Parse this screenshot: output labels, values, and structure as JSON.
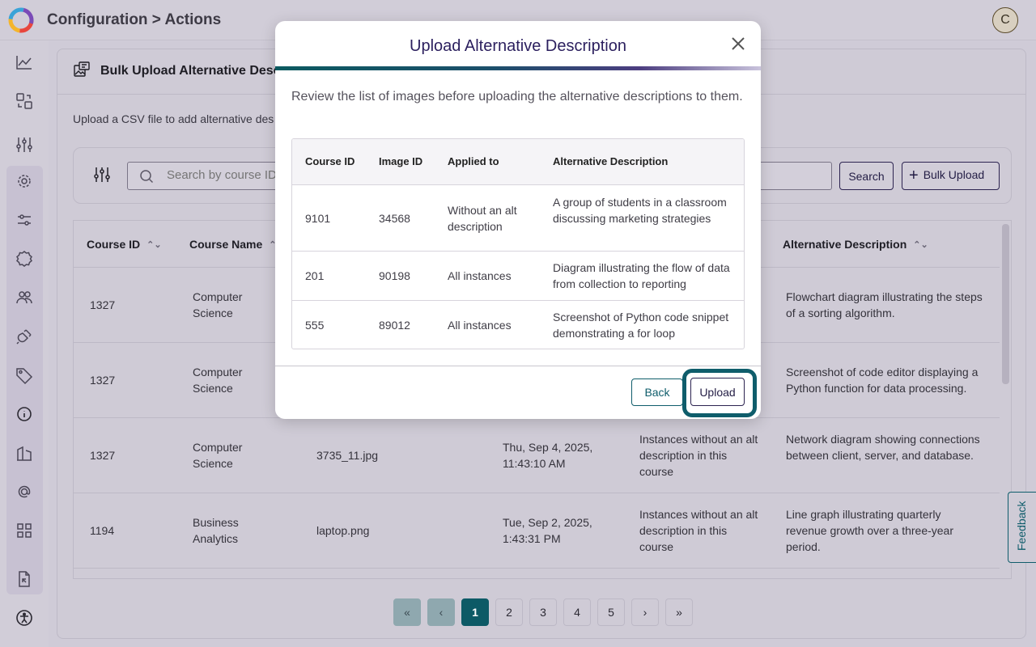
{
  "header": {
    "title": "Configuration > Actions",
    "avatar_initial": "C"
  },
  "section": {
    "title": "Bulk Upload Alternative Descr",
    "intro": "Upload a CSV file to add alternative des"
  },
  "filter": {
    "search_placeholder": "Search by course ID",
    "search_label": "Search",
    "bulk_label": "Bulk Upload"
  },
  "table": {
    "headers": [
      "Course ID",
      "Course Name",
      "Alternative Description"
    ],
    "rows": [
      {
        "course_id": "1327",
        "course_name": "Computer Science",
        "file": "",
        "date": "",
        "applied": "",
        "alt": "Flowchart diagram illustrating the steps of a sorting algorithm."
      },
      {
        "course_id": "1327",
        "course_name": "Computer Science",
        "file": "",
        "date": "",
        "applied": "",
        "alt": "Screenshot of code editor displaying a Python function for data processing."
      },
      {
        "course_id": "1327",
        "course_name": "Computer Science",
        "file": "3735_11.jpg",
        "date": "Thu, Sep 4, 2025, 11:43:10 AM",
        "applied": "Instances without an alt description in this course",
        "alt": "Network diagram showing connections between client, server, and database."
      },
      {
        "course_id": "1194",
        "course_name": "Business Analytics",
        "file": "laptop.png",
        "date": "Tue, Sep 2, 2025, 1:43:31 PM",
        "applied": "Instances without an alt description in this course",
        "alt": "Line graph illustrating quarterly revenue growth over a three-year period."
      }
    ]
  },
  "pagination": {
    "first": "«",
    "prev": "‹",
    "pages": [
      "1",
      "2",
      "3",
      "4",
      "5"
    ],
    "next": "›",
    "last": "»",
    "current": "1"
  },
  "feedback_label": "Feedback",
  "modal": {
    "title": "Upload Alternative Description",
    "description": "Review the list of images before uploading the alternative descriptions to them.",
    "headers": [
      "Course ID",
      "Image ID",
      "Applied to",
      "Alternative Description"
    ],
    "rows": [
      {
        "course_id": "9101",
        "image_id": "34568",
        "applied": "Without an alt description",
        "alt": "A group of students in a classroom discussing marketing strategies"
      },
      {
        "course_id": "201",
        "image_id": "90198",
        "applied": "All instances",
        "alt": "Diagram illustrating the flow of data from collection to reporting"
      },
      {
        "course_id": "555",
        "image_id": "89012",
        "applied": "All instances",
        "alt": "Screenshot of Python code snippet demonstrating a for loop"
      }
    ],
    "back_label": "Back",
    "upload_label": "Upload"
  },
  "icons": {
    "sidebar": [
      "chart-line-icon",
      "transfer-icon",
      "sliders-icon",
      "gear-icon",
      "filter-sliders-icon",
      "badge-icon",
      "users-icon",
      "plug-icon",
      "tag-icon",
      "info-icon",
      "building-icon",
      "at-sign-icon",
      "grid-icon",
      "file-import-icon",
      "accessibility-icon"
    ]
  },
  "colors": {
    "accent": "#0f5d6b",
    "primary_text": "#2b1f5e"
  }
}
